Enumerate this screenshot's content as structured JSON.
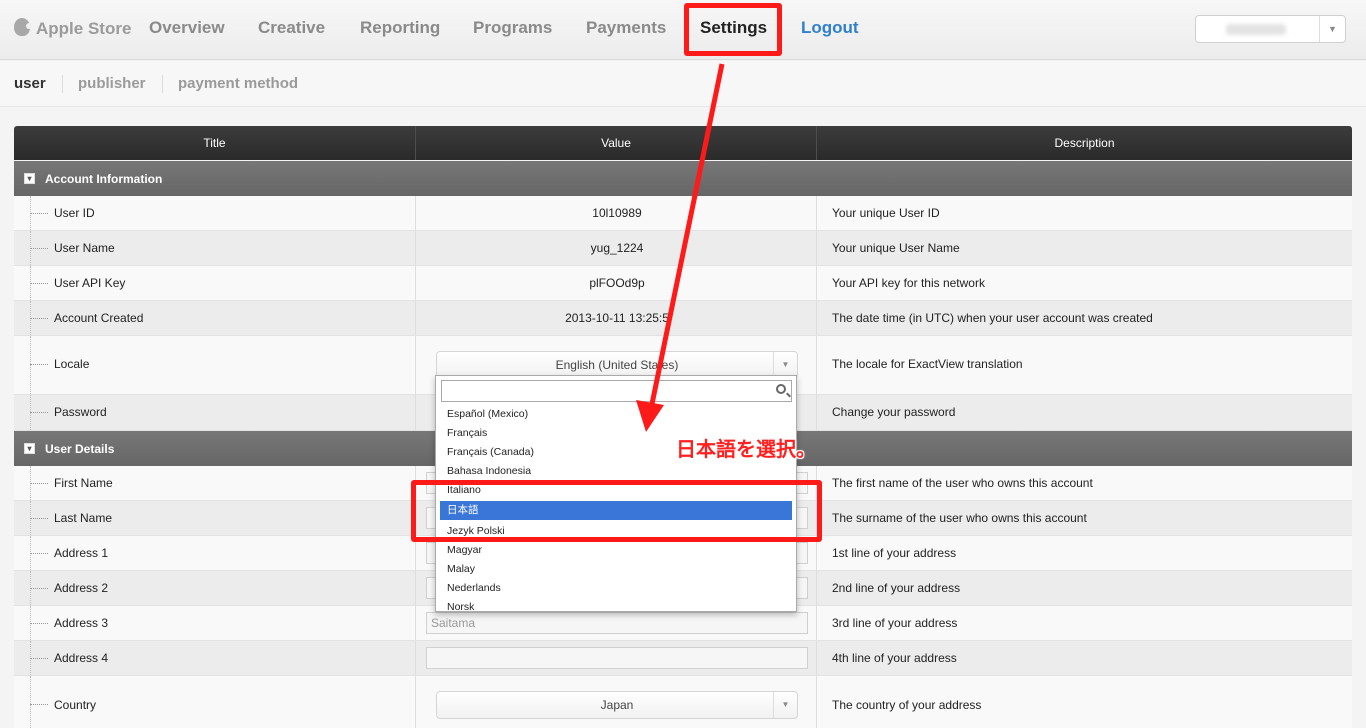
{
  "topnav": {
    "brand": "Apple Store",
    "items": [
      "Overview",
      "Creative",
      "Reporting",
      "Programs",
      "Payments",
      "Settings"
    ],
    "logout": "Logout"
  },
  "subnav": {
    "items": [
      "user",
      "publisher",
      "payment method"
    ]
  },
  "table": {
    "headers": [
      "Title",
      "Value",
      "Description"
    ],
    "sections": [
      {
        "label": "Account Information",
        "rows": [
          {
            "title": "User ID",
            "value": "10l10989",
            "desc": "Your unique User ID"
          },
          {
            "title": "User Name",
            "value": "yug_1224",
            "desc": "Your unique User Name"
          },
          {
            "title": "User API Key",
            "value": "plFOOd9p",
            "desc": "Your API key for this network"
          },
          {
            "title": "Account Created",
            "value": "2013-10-11 13:25:5",
            "desc": "The date time (in UTC) when your user account was created"
          },
          {
            "title": "Locale",
            "value": "English (United States)",
            "desc": "The locale for ExactView translation"
          },
          {
            "title": "Password",
            "value": "",
            "desc": "Change your password"
          }
        ]
      },
      {
        "label": "User Details",
        "rows": [
          {
            "title": "First Name",
            "value": "",
            "desc": "The first name of the user who owns this account"
          },
          {
            "title": "Last Name",
            "value": "",
            "desc": "The surname of the user who owns this account"
          },
          {
            "title": "Address 1",
            "value": "",
            "desc": "1st line of your address"
          },
          {
            "title": "Address 2",
            "value": "",
            "desc": "2nd line of your address"
          },
          {
            "title": "Address 3",
            "value": "Saitama",
            "desc": "3rd line of your address"
          },
          {
            "title": "Address 4",
            "value": "",
            "desc": "4th line of your address"
          },
          {
            "title": "Country",
            "value": "Japan",
            "desc": "The country of your address"
          }
        ]
      }
    ]
  },
  "locale_dropdown": {
    "search_value": "",
    "options": [
      "Español (Mexico)",
      "Français",
      "Français (Canada)",
      "Bahasa Indonesia",
      "Italiano",
      "日本語",
      "Jezyk Polski",
      "Magyar",
      "Malay",
      "Nederlands",
      "Norsk"
    ],
    "selected": "日本語"
  },
  "annotation": {
    "text": "日本語を選択。",
    "color": "#ff1a1a"
  },
  "colors": {
    "accent": "#2f7fd0",
    "selection": "#3a76d8",
    "header": "#333333"
  }
}
